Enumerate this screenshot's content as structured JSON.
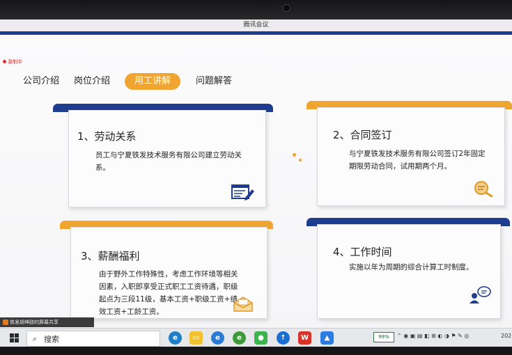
{
  "window": {
    "title": "腾讯会议"
  },
  "recording": {
    "label": "录制中"
  },
  "nav": [
    {
      "label": "公司介绍",
      "active": false
    },
    {
      "label": "岗位介绍",
      "active": false
    },
    {
      "label": "用工讲解",
      "active": true
    },
    {
      "label": "问题解答",
      "active": false
    }
  ],
  "cards": [
    {
      "title": "1、劳动关系",
      "body": "员工与宁夏铁发技术服务有限公司建立劳动关系。",
      "tab_color": "#1f3d8f",
      "icon": "form-edit-icon"
    },
    {
      "title": "2、合同签订",
      "body": "与宁夏铁发技术服务有限公司签订2年固定期限劳动合同，试用期两个月。",
      "tab_color": "#f0a530",
      "icon": "document-search-icon"
    },
    {
      "title": "3、薪酬福利",
      "body": "由于野外工作特殊性，考虑工作环境等相关因素，入职即享受正式职工工资待遇，职级起点为三段11级，基本工资+职级工资+绩效工资+工龄工资。",
      "tab_color": "#f0a530",
      "icon": "envelope-icon"
    },
    {
      "title": "4、工作时间",
      "body": "实施以年为周期的综合计算工时制度。",
      "tab_color": "#1f3d8f",
      "icon": "chat-person-icon"
    }
  ],
  "share_bar": {
    "text": "铁发胡坤辞的屏幕共享"
  },
  "taskbar": {
    "search_placeholder": "搜索",
    "battery": "99%",
    "clock_fragment": "202"
  },
  "colors": {
    "brand_blue": "#1f3d8f",
    "accent_orange": "#f0a530"
  }
}
